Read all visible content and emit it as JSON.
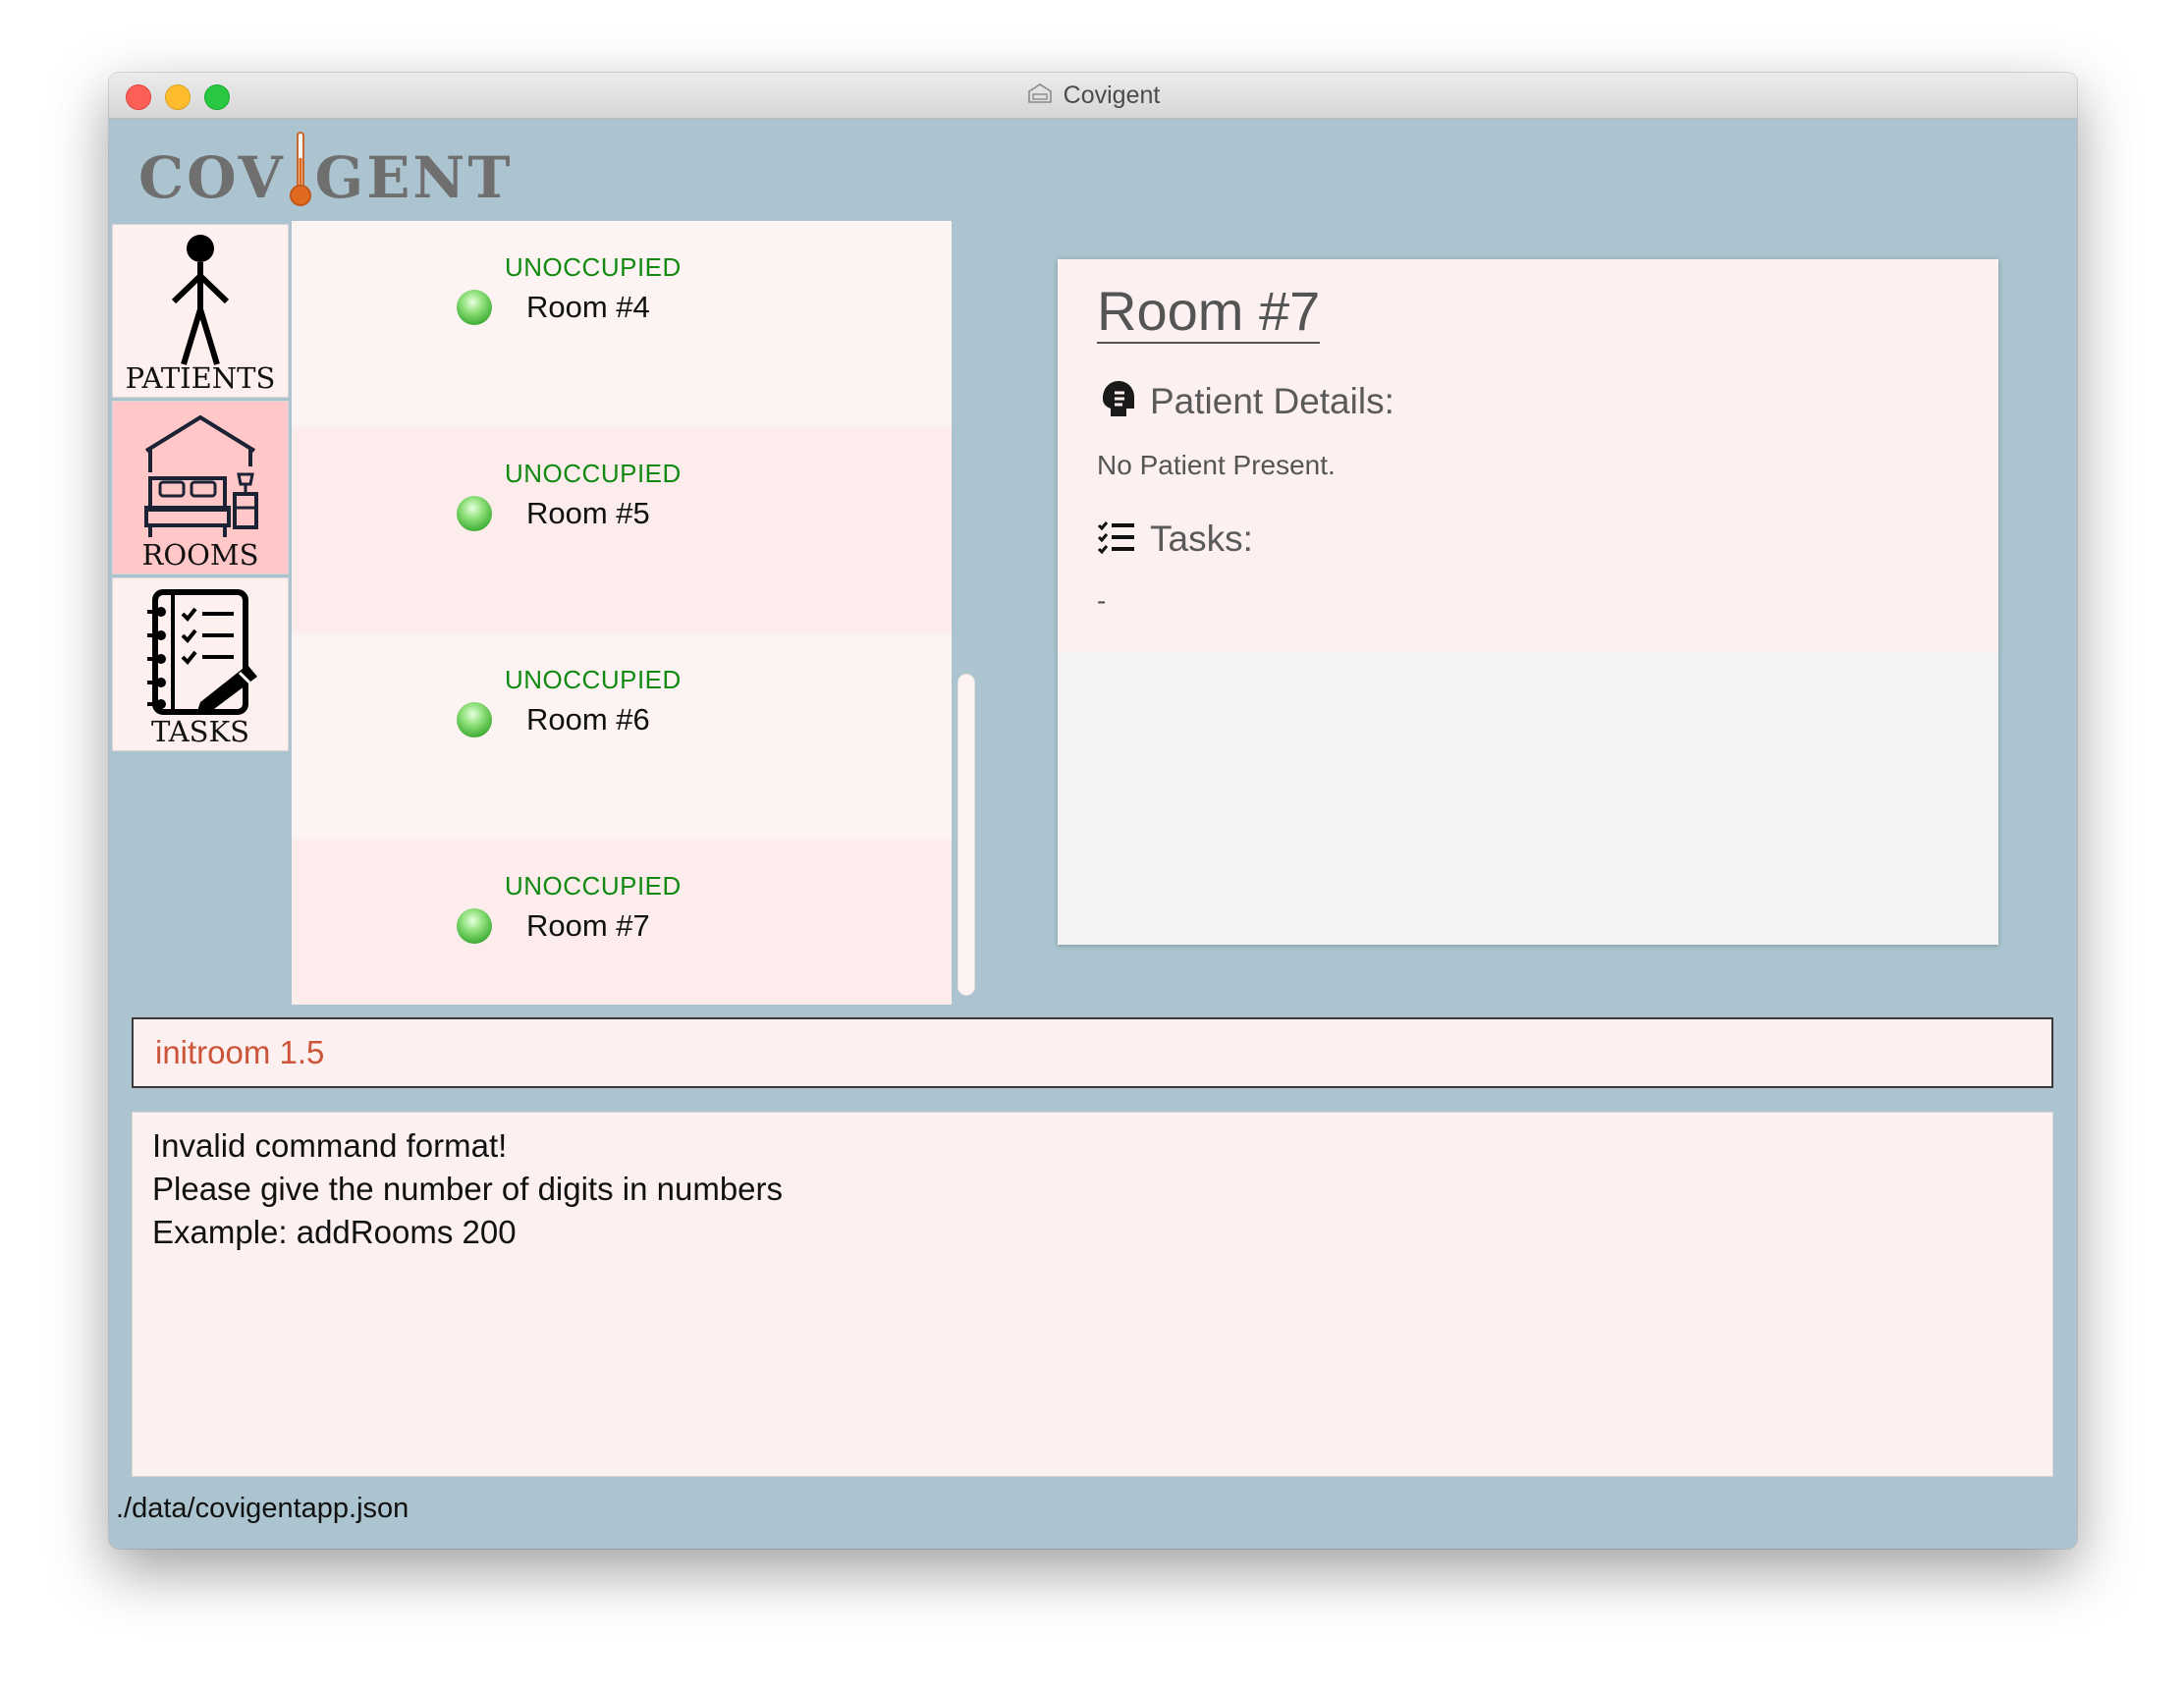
{
  "window": {
    "title": "Covigent"
  },
  "logo": {
    "left": "COV",
    "right": "GENT"
  },
  "nav": {
    "items": [
      {
        "label": "PATIENTS",
        "icon": "stick-figure-icon",
        "active": false
      },
      {
        "label": "ROOMS",
        "icon": "bedroom-icon",
        "active": true
      },
      {
        "label": "TASKS",
        "icon": "checklist-notebook-icon",
        "active": false
      }
    ]
  },
  "rooms": [
    {
      "status": "UNOCCUPIED",
      "name": "Room #4"
    },
    {
      "status": "UNOCCUPIED",
      "name": "Room #5"
    },
    {
      "status": "UNOCCUPIED",
      "name": "Room #6"
    },
    {
      "status": "UNOCCUPIED",
      "name": "Room #7"
    }
  ],
  "detail": {
    "title": "Room #7",
    "patient_heading": "Patient Details:",
    "patient_text": "No Patient Present.",
    "tasks_heading": "Tasks:",
    "tasks_text": "-"
  },
  "command": {
    "value": "initroom 1.5"
  },
  "result": {
    "lines": [
      "Invalid command format!",
      "Please give the number of digits in numbers",
      "Example: addRooms 200"
    ]
  },
  "status_bar": {
    "path": "./data/covigentapp.json"
  },
  "colors": {
    "window_bg": "#abc4cf",
    "panel_pink": "#fdf0f0",
    "active_nav": "#ffc7c7",
    "status_green": "#128a12",
    "command_text": "#cc5438"
  }
}
